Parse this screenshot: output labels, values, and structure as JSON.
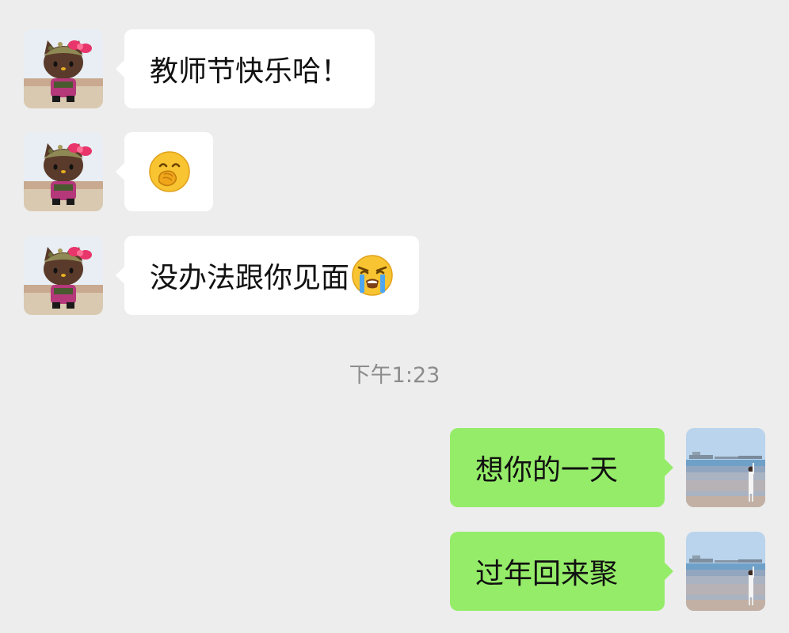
{
  "chat": {
    "messages": [
      {
        "side": "received",
        "text": "教师节快乐哈！",
        "emoji": ""
      },
      {
        "side": "received",
        "text": "",
        "emoji": "hand-over-mouth-emoji"
      },
      {
        "side": "received",
        "text": "没办法跟你见面",
        "emoji": "loudly-crying-emoji"
      },
      {
        "side": "sent",
        "text": "想你的一天",
        "emoji": ""
      },
      {
        "side": "sent",
        "text": "过年回来聚",
        "emoji": ""
      }
    ],
    "timestamp": "下午1:23"
  },
  "avatars": {
    "friend": "hello-kitty-avatar",
    "me": "beach-photo-avatar"
  },
  "colors": {
    "background": "#ededed",
    "received_bubble": "#ffffff",
    "sent_bubble": "#95ec69",
    "timestamp_text": "#8c8c8c"
  }
}
